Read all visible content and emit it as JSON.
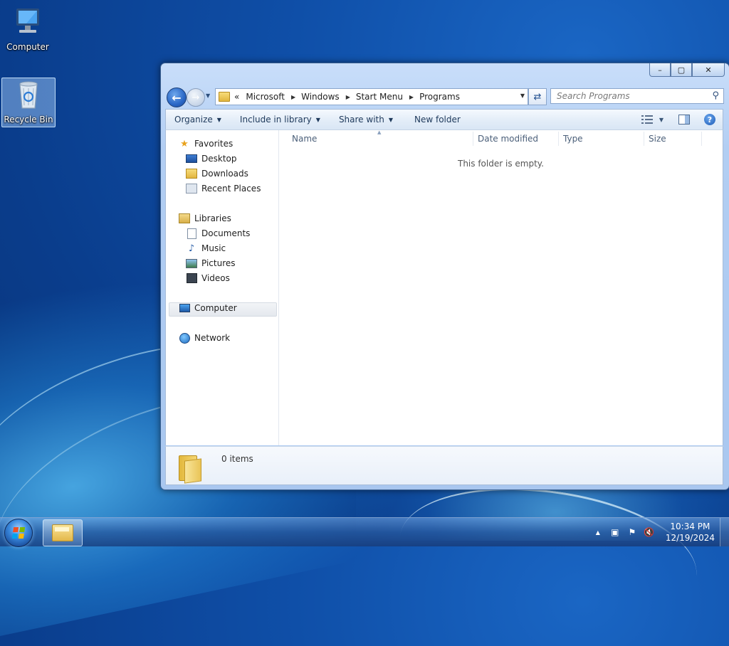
{
  "desktop": {
    "icons": [
      {
        "label": "Computer"
      },
      {
        "label": "Recycle Bin"
      }
    ]
  },
  "window": {
    "controls": {
      "minimize": "–",
      "maximize": "▢",
      "close": "✕"
    },
    "address": {
      "overflow": "«",
      "crumbs": [
        "Microsoft",
        "Windows",
        "Start Menu",
        "Programs"
      ]
    },
    "search": {
      "placeholder": "Search Programs"
    },
    "toolbar": {
      "organize": "Organize",
      "include_in_library": "Include in library",
      "share_with": "Share with",
      "new_folder": "New folder"
    },
    "nav": {
      "favorites": "Favorites",
      "desktop": "Desktop",
      "downloads": "Downloads",
      "recent_places": "Recent Places",
      "libraries": "Libraries",
      "documents": "Documents",
      "music": "Music",
      "pictures": "Pictures",
      "videos": "Videos",
      "computer": "Computer",
      "network": "Network"
    },
    "columns": {
      "name": "Name",
      "date_modified": "Date modified",
      "type": "Type",
      "size": "Size"
    },
    "empty_message": "This folder is empty.",
    "status": {
      "items": "0 items"
    }
  },
  "taskbar": {
    "clock": {
      "time": "10:34 PM",
      "date": "12/19/2024"
    }
  }
}
